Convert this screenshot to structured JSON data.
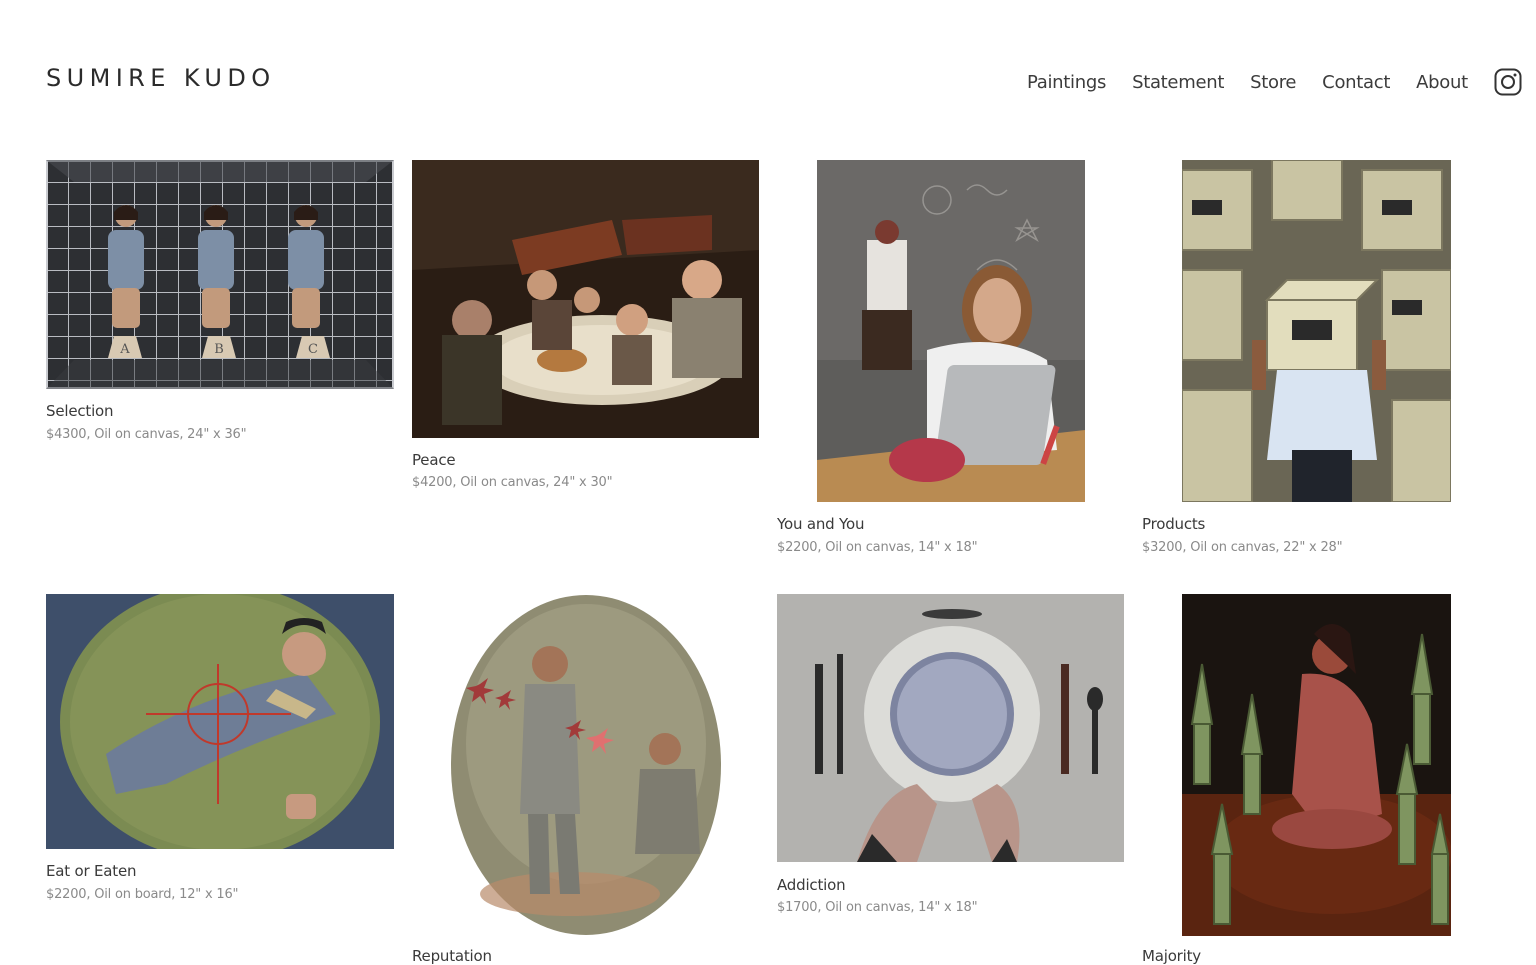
{
  "site": {
    "logo": "SUMIRE KUDO"
  },
  "nav": {
    "items": [
      "Paintings",
      "Statement",
      "Store",
      "Contact",
      "About"
    ],
    "instagram_icon": "instagram-icon"
  },
  "artworks": [
    {
      "title": "Selection",
      "meta": "$4300, Oil on canvas, 24\" x 36\"",
      "labels": [
        "A",
        "B",
        "C"
      ]
    },
    {
      "title": "Peace",
      "meta": "$4200, Oil on canvas, 24\" x 30\""
    },
    {
      "title": "You and You",
      "meta": "$2200, Oil on canvas, 14\" x 18\""
    },
    {
      "title": "Products",
      "meta": "$3200, Oil on canvas, 22\" x 28\""
    },
    {
      "title": "Eat or Eaten",
      "meta": "$2200, Oil on board, 12\" x 16\""
    },
    {
      "title": "Reputation",
      "meta": ""
    },
    {
      "title": "Addiction",
      "meta": "$1700, Oil on canvas, 14\" x 18\""
    },
    {
      "title": "Majority",
      "meta": ""
    }
  ],
  "colors": {
    "text": "#333333",
    "meta": "#8a8a8a",
    "background": "#ffffff"
  }
}
